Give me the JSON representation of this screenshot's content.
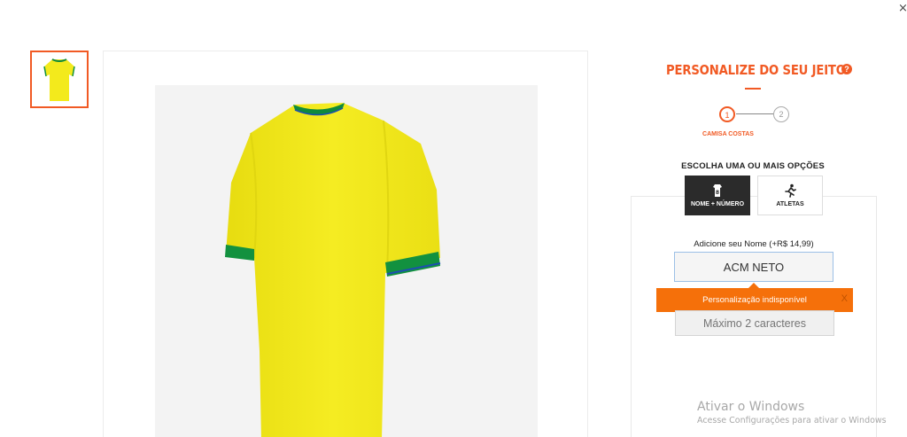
{
  "window": {
    "close_glyph": "×"
  },
  "product": {
    "thumbnail_alt": "Camisa amarela - costas",
    "image_alt": "Camisa amarela vista de costas",
    "colors": {
      "shirt": "#f3ea1c",
      "collar": "#0f8a3c",
      "collar_trim": "#1d4fb0",
      "cuff_green": "#12913f"
    }
  },
  "personalize": {
    "title": "PERSONALIZE DO SEU JEITO",
    "help_glyph": "?",
    "steps": [
      {
        "number": "1",
        "label": "CAMISA COSTAS"
      },
      {
        "number": "2"
      }
    ],
    "options_heading": "ESCOLHA UMA OU MAIS OPÇÕES",
    "options": [
      {
        "label": "NOME + NÚMERO",
        "icon": "jersey-icon",
        "selected": true
      },
      {
        "label": "ATLETAS",
        "icon": "runner-icon",
        "selected": false
      }
    ],
    "name_label": "Adicione seu Nome (+R$ 14,99)",
    "name_value": "ACM NETO",
    "error_message": "Personalização indisponível",
    "error_close": "X",
    "number_placeholder": "Máximo 2 caracteres"
  },
  "accent_color": "#f15a24",
  "error_color": "#f5700a",
  "os_watermark": {
    "title": "Ativar o Windows",
    "subtitle": "Acesse Configurações para ativar o Windows"
  }
}
